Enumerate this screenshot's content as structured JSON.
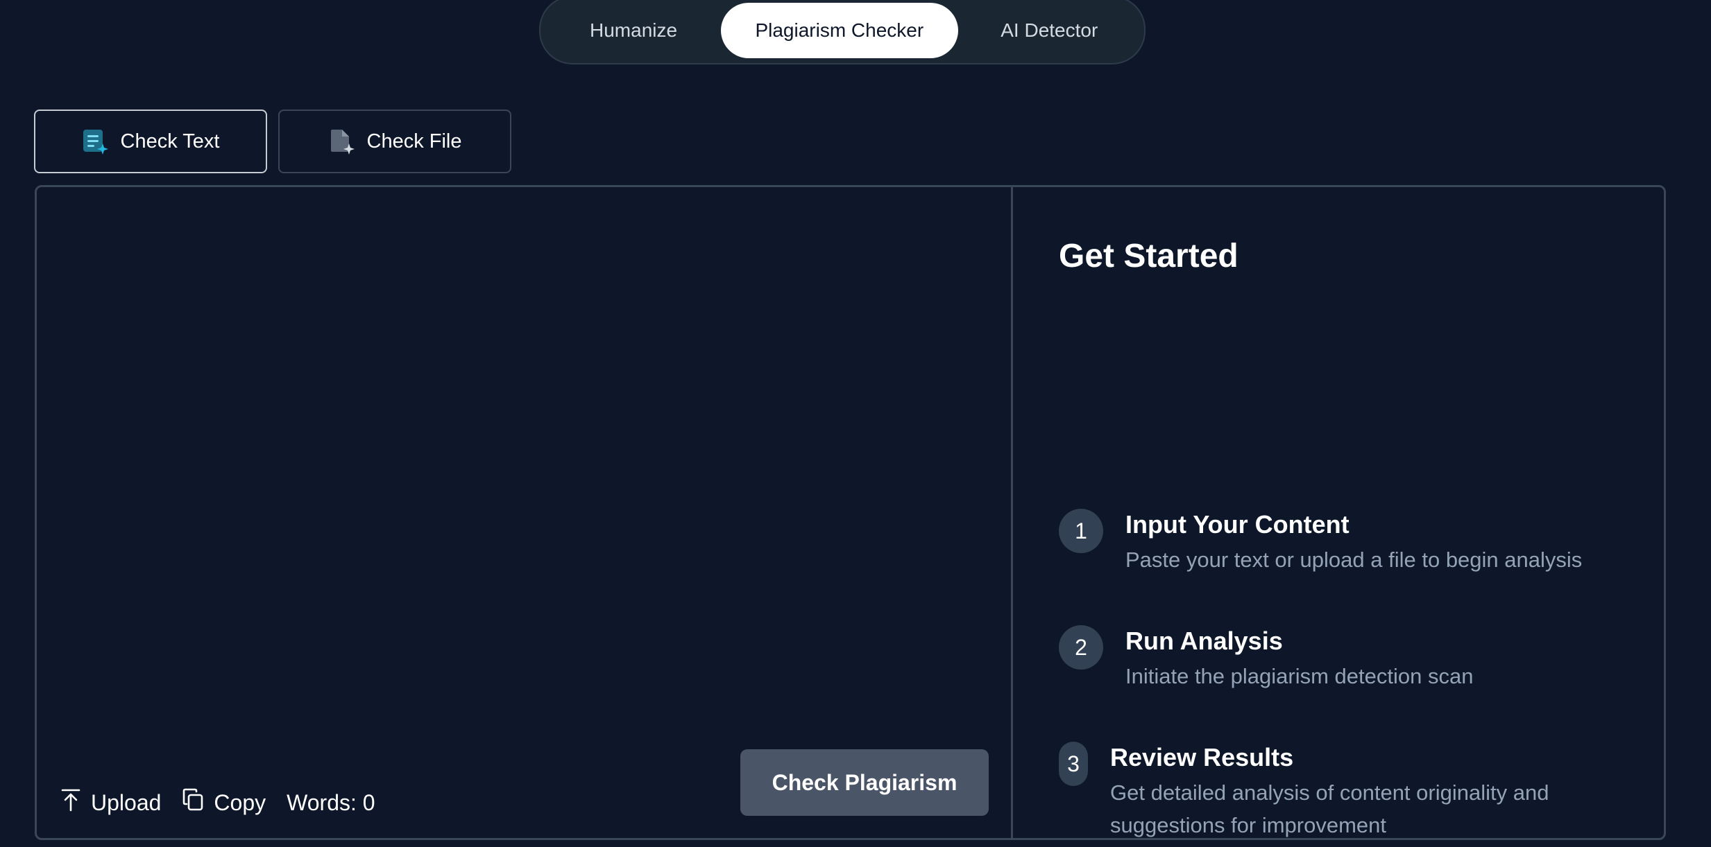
{
  "top_tabs": [
    {
      "label": "Humanize"
    },
    {
      "label": "Plagiarism Checker"
    },
    {
      "label": "AI Detector"
    }
  ],
  "mode_buttons": {
    "check_text": "Check Text",
    "check_file": "Check File"
  },
  "editor": {
    "placeholder": "",
    "upload_label": "Upload",
    "copy_label": "Copy",
    "words_label": "Words: 0",
    "check_button": "Check Plagiarism"
  },
  "side": {
    "title": "Get Started",
    "steps": [
      {
        "num": "1",
        "title": "Input Your Content",
        "desc": "Paste your text or upload a file to begin analysis"
      },
      {
        "num": "2",
        "title": "Run Analysis",
        "desc": "Initiate the plagiarism detection scan"
      },
      {
        "num": "3",
        "title": "Review Results",
        "desc": "Get detailed analysis of content originality and suggestions for improvement"
      }
    ]
  },
  "colors": {
    "background": "#0e1729",
    "active_tab_bg": "#ffffff",
    "check_button_bg": "#4a5568",
    "step_badge_bg": "#334155",
    "muted_text": "#94a3b8",
    "icon_accent": "#22b8e0"
  },
  "icons": {
    "check_text": "document-sparkle-icon",
    "check_file": "file-sparkle-icon",
    "upload": "upload-icon",
    "copy": "copy-icon"
  }
}
